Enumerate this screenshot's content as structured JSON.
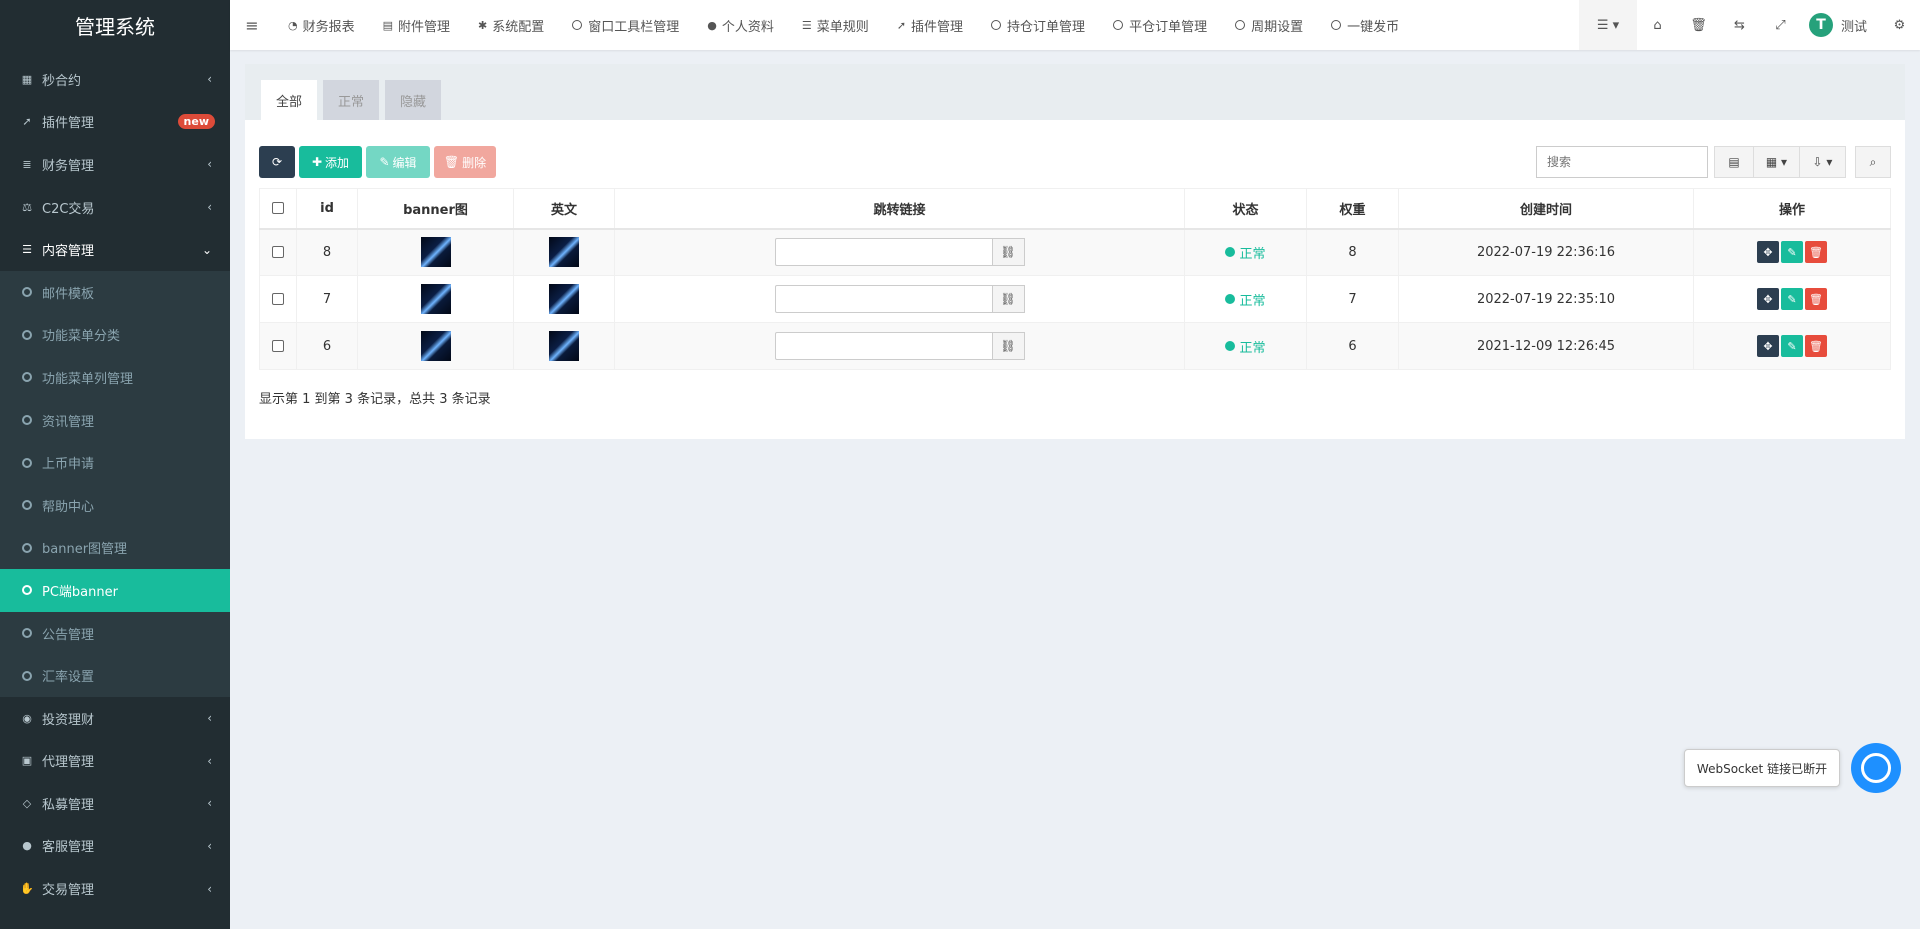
{
  "app": {
    "title": "管理系统"
  },
  "sidebar": {
    "items_top": [
      {
        "label": "秒合约",
        "icon": "calendar-icon",
        "chevron": "‹"
      },
      {
        "label": "插件管理",
        "icon": "rocket-icon",
        "badge": "new"
      },
      {
        "label": "财务管理",
        "icon": "database-icon",
        "chevron": "‹"
      },
      {
        "label": "C2C交易",
        "icon": "balance-scale-icon",
        "chevron": "‹"
      },
      {
        "label": "内容管理",
        "icon": "list-icon",
        "chevron": "⌄"
      }
    ],
    "submenu": [
      "邮件模板",
      "功能菜单分类",
      "功能菜单列管理",
      "资讯管理",
      "上币申请",
      "帮助中心",
      "banner图管理",
      "PC端banner",
      "公告管理",
      "汇率设置"
    ],
    "active_sub": "PC端banner",
    "items_bottom": [
      {
        "label": "投资理财",
        "icon": "compass-icon",
        "chevron": "‹"
      },
      {
        "label": "代理管理",
        "icon": "briefcase-icon",
        "chevron": "‹"
      },
      {
        "label": "私募管理",
        "icon": "diamond-icon",
        "chevron": "‹"
      },
      {
        "label": "客服管理",
        "icon": "comment-icon",
        "chevron": "‹"
      },
      {
        "label": "交易管理",
        "icon": "handshake-icon",
        "chevron": "‹"
      }
    ]
  },
  "header": {
    "tabs": [
      {
        "label": "财务报表",
        "icon": "dashboard-icon"
      },
      {
        "label": "附件管理",
        "icon": "file-image-icon"
      },
      {
        "label": "系统配置",
        "icon": "gear-icon"
      },
      {
        "label": "窗口工具栏管理",
        "icon": "circle-icon"
      },
      {
        "label": "个人资料",
        "icon": "user-icon"
      },
      {
        "label": "菜单规则",
        "icon": "bars-icon"
      },
      {
        "label": "插件管理",
        "icon": "rocket-icon"
      },
      {
        "label": "持仓订单管理",
        "icon": "circle-icon"
      },
      {
        "label": "平仓订单管理",
        "icon": "circle-icon"
      },
      {
        "label": "周期设置",
        "icon": "circle-icon"
      },
      {
        "label": "一键发币",
        "icon": "circle-icon"
      }
    ],
    "user_name": "测试"
  },
  "content": {
    "tabs": [
      "全部",
      "正常",
      "隐藏"
    ],
    "toolbar": {
      "add_label": "添加",
      "edit_label": "编辑",
      "delete_label": "删除",
      "search_placeholder": "搜索"
    },
    "table": {
      "headers": [
        "id",
        "banner图",
        "英文",
        "跳转链接",
        "状态",
        "权重",
        "创建时间",
        "操作"
      ],
      "rows": [
        {
          "id": "8",
          "status": "正常",
          "weight": "8",
          "created": "2022-07-19 22:36:16",
          "link": ""
        },
        {
          "id": "7",
          "status": "正常",
          "weight": "7",
          "created": "2022-07-19 22:35:10",
          "link": ""
        },
        {
          "id": "6",
          "status": "正常",
          "weight": "6",
          "created": "2021-12-09 12:26:45",
          "link": ""
        }
      ]
    },
    "summary": "显示第 1 到第 3 条记录，总共 3 条记录"
  },
  "websocket": {
    "message": "WebSocket 链接已断开"
  },
  "colors": {
    "sidebar_bg": "#222d32",
    "accent": "#18bc9c",
    "danger": "#e74c3c",
    "dark": "#2c3e50"
  }
}
